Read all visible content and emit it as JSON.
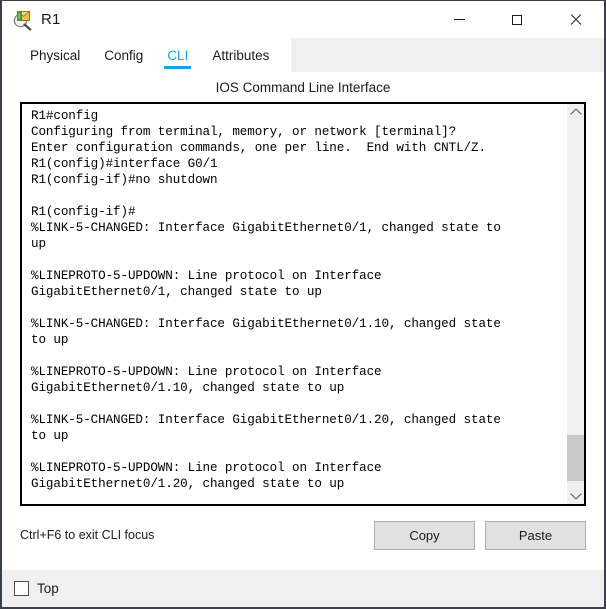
{
  "window": {
    "title": "R1",
    "icon": "router-inspect-icon",
    "controls": {
      "minimize": "Minimize",
      "maximize": "Maximize",
      "close": "Close"
    }
  },
  "tabs": [
    {
      "label": "Physical",
      "active": false
    },
    {
      "label": "Config",
      "active": false
    },
    {
      "label": "CLI",
      "active": true
    },
    {
      "label": "Attributes",
      "active": false
    }
  ],
  "panel": {
    "heading": "IOS Command Line Interface",
    "terminal_text": "R1#config\nConfiguring from terminal, memory, or network [terminal]?\nEnter configuration commands, one per line.  End with CNTL/Z.\nR1(config)#interface G0/1\nR1(config-if)#no shutdown\n\nR1(config-if)#\n%LINK-5-CHANGED: Interface GigabitEthernet0/1, changed state to\nup\n\n%LINEPROTO-5-UPDOWN: Line protocol on Interface\nGigabitEthernet0/1, changed state to up\n\n%LINK-5-CHANGED: Interface GigabitEthernet0/1.10, changed state\nto up\n\n%LINEPROTO-5-UPDOWN: Line protocol on Interface\nGigabitEthernet0/1.10, changed state to up\n\n%LINK-5-CHANGED: Interface GigabitEthernet0/1.20, changed state\nto up\n\n%LINEPROTO-5-UPDOWN: Line protocol on Interface\nGigabitEthernet0/1.20, changed state to up"
  },
  "actions": {
    "hint": "Ctrl+F6 to exit CLI focus",
    "copy_label": "Copy",
    "paste_label": "Paste"
  },
  "footer": {
    "top_label": "Top",
    "top_checked": false
  },
  "colors": {
    "accent": "#12a5e8",
    "window_border": "#3a4049",
    "chrome_gray": "#f0f0f0",
    "button_face": "#e1e1e1",
    "scroll_thumb": "#c9c9c9"
  }
}
